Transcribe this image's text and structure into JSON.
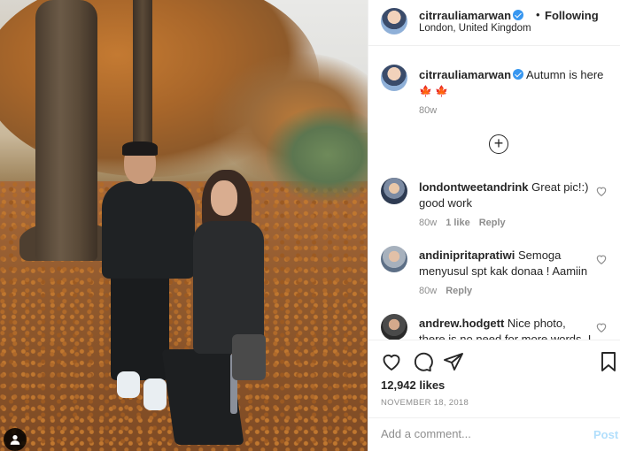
{
  "post": {
    "author": "citrrauliamarwan",
    "follow_status": "Following",
    "separator": "•",
    "location": "London, United Kingdom",
    "caption_text": "Autumn is here",
    "caption_emojis": "🍁🍁",
    "caption_time": "80w",
    "likes": "12,942 likes",
    "date": "NOVEMBER 18, 2018"
  },
  "comments": [
    {
      "username": "londontweetandrink",
      "text": "Great pic!:) good work",
      "time": "80w",
      "likes": "1 like",
      "reply": "Reply"
    },
    {
      "username": "andiniprita­pratiwi",
      "text": "Semoga menyusul spt kak donaa ! Aamiin",
      "time": "80w",
      "reply": "Reply"
    },
    {
      "username": "andrew.hodgett",
      "text": "Nice photo, there is no need for more words. I"
    }
  ],
  "add_comment": {
    "placeholder": "Add a comment...",
    "post_label": "Post"
  },
  "icons": {
    "verified": "verified-badge-icon",
    "load_more": "plus-circle-icon",
    "like": "heart-icon",
    "comment": "comment-icon",
    "share": "paper-plane-icon",
    "save": "bookmark-icon",
    "user_tag": "user-tag-icon"
  },
  "colors": {
    "verified": "#3897f0",
    "post_disabled": "#b2dffc",
    "muted_text": "#8e8e8e"
  }
}
